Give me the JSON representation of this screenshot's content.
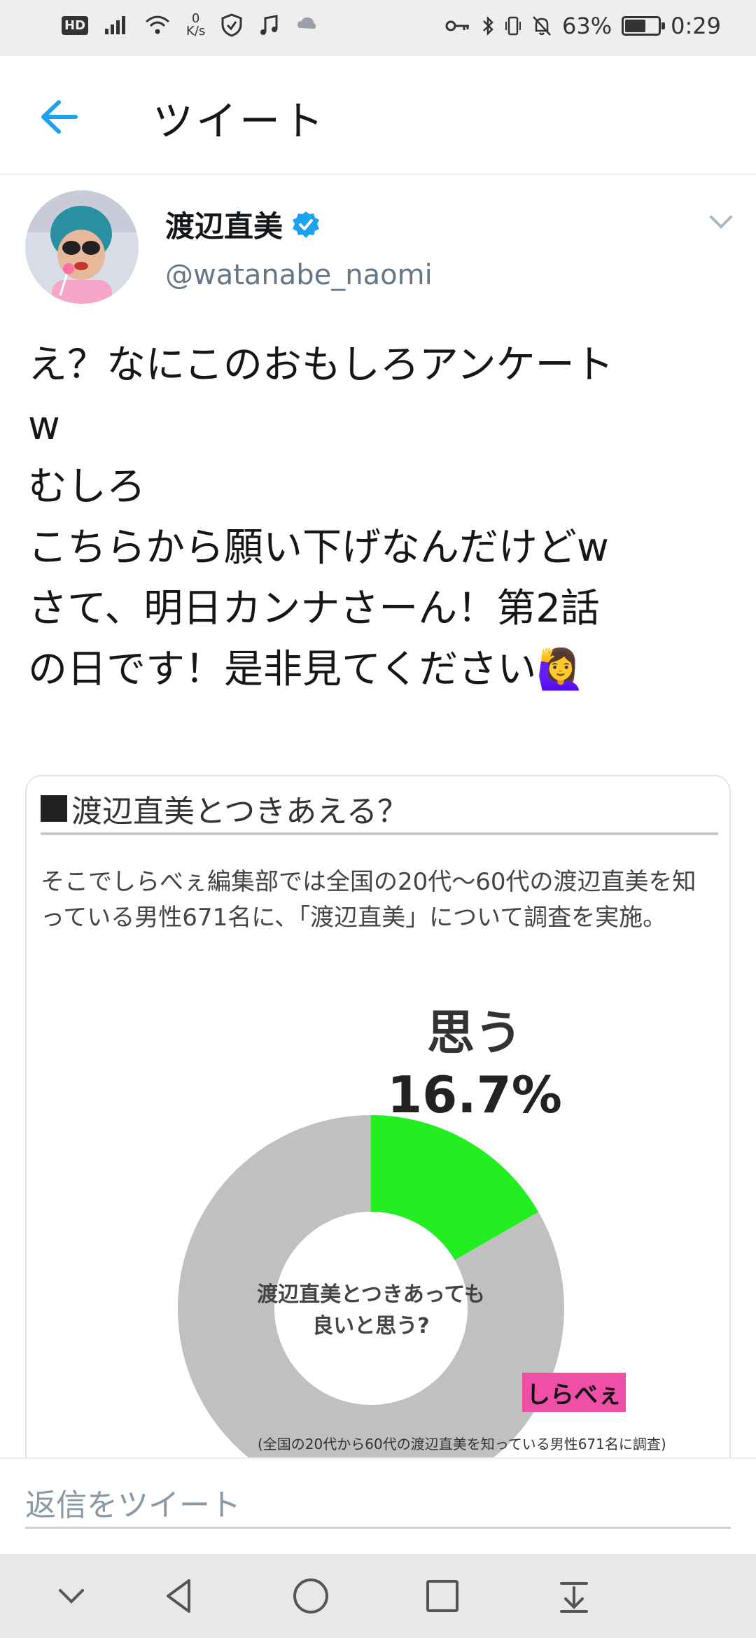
{
  "status_bar": {
    "hd": "HD",
    "speed_value": "0",
    "speed_unit": "K/s",
    "battery_percent": "63%",
    "battery_level": 0.63,
    "time": "0:29"
  },
  "header": {
    "title": "ツイート"
  },
  "tweet": {
    "display_name": "渡辺直美",
    "handle": "@watanabe_naomi",
    "text": "え？なにこのおもしろアンケート\nw\nむしろ\nこちらから願い下げなんだけどw\nさて、明日カンナさーん！第2話\nの日です！是非見てください🙋‍♀️"
  },
  "card": {
    "heading": "渡辺直美とつきあえる？",
    "body": "そこでしらべぇ編集部では全国の20代〜60代の渡辺直美を知っている男性671名に、「渡辺直美」について調査を実施。",
    "note": "(全国の20代から60代の渡辺直美を知っている男性671名に調査)",
    "logo": "しらべぇ"
  },
  "chart_data": {
    "type": "pie",
    "title": "渡辺直美とつきあっても良いと思う?",
    "slices": [
      {
        "label": "思う",
        "value": 16.7,
        "color": "#22ee22"
      },
      {
        "label": "",
        "value": 83.3,
        "color": "#c0c0c0"
      }
    ],
    "center_text_line1": "渡辺直美とつきあっても",
    "center_text_line2": "良いと思う?",
    "highlight_label": "思う",
    "highlight_value": "16.7%"
  },
  "reply": {
    "placeholder": "返信をツイート"
  },
  "colors": {
    "accent": "#1da1f2",
    "verified": "#1da1f2",
    "chart_highlight": "#22ee22",
    "chart_rest": "#c0c0c0"
  }
}
